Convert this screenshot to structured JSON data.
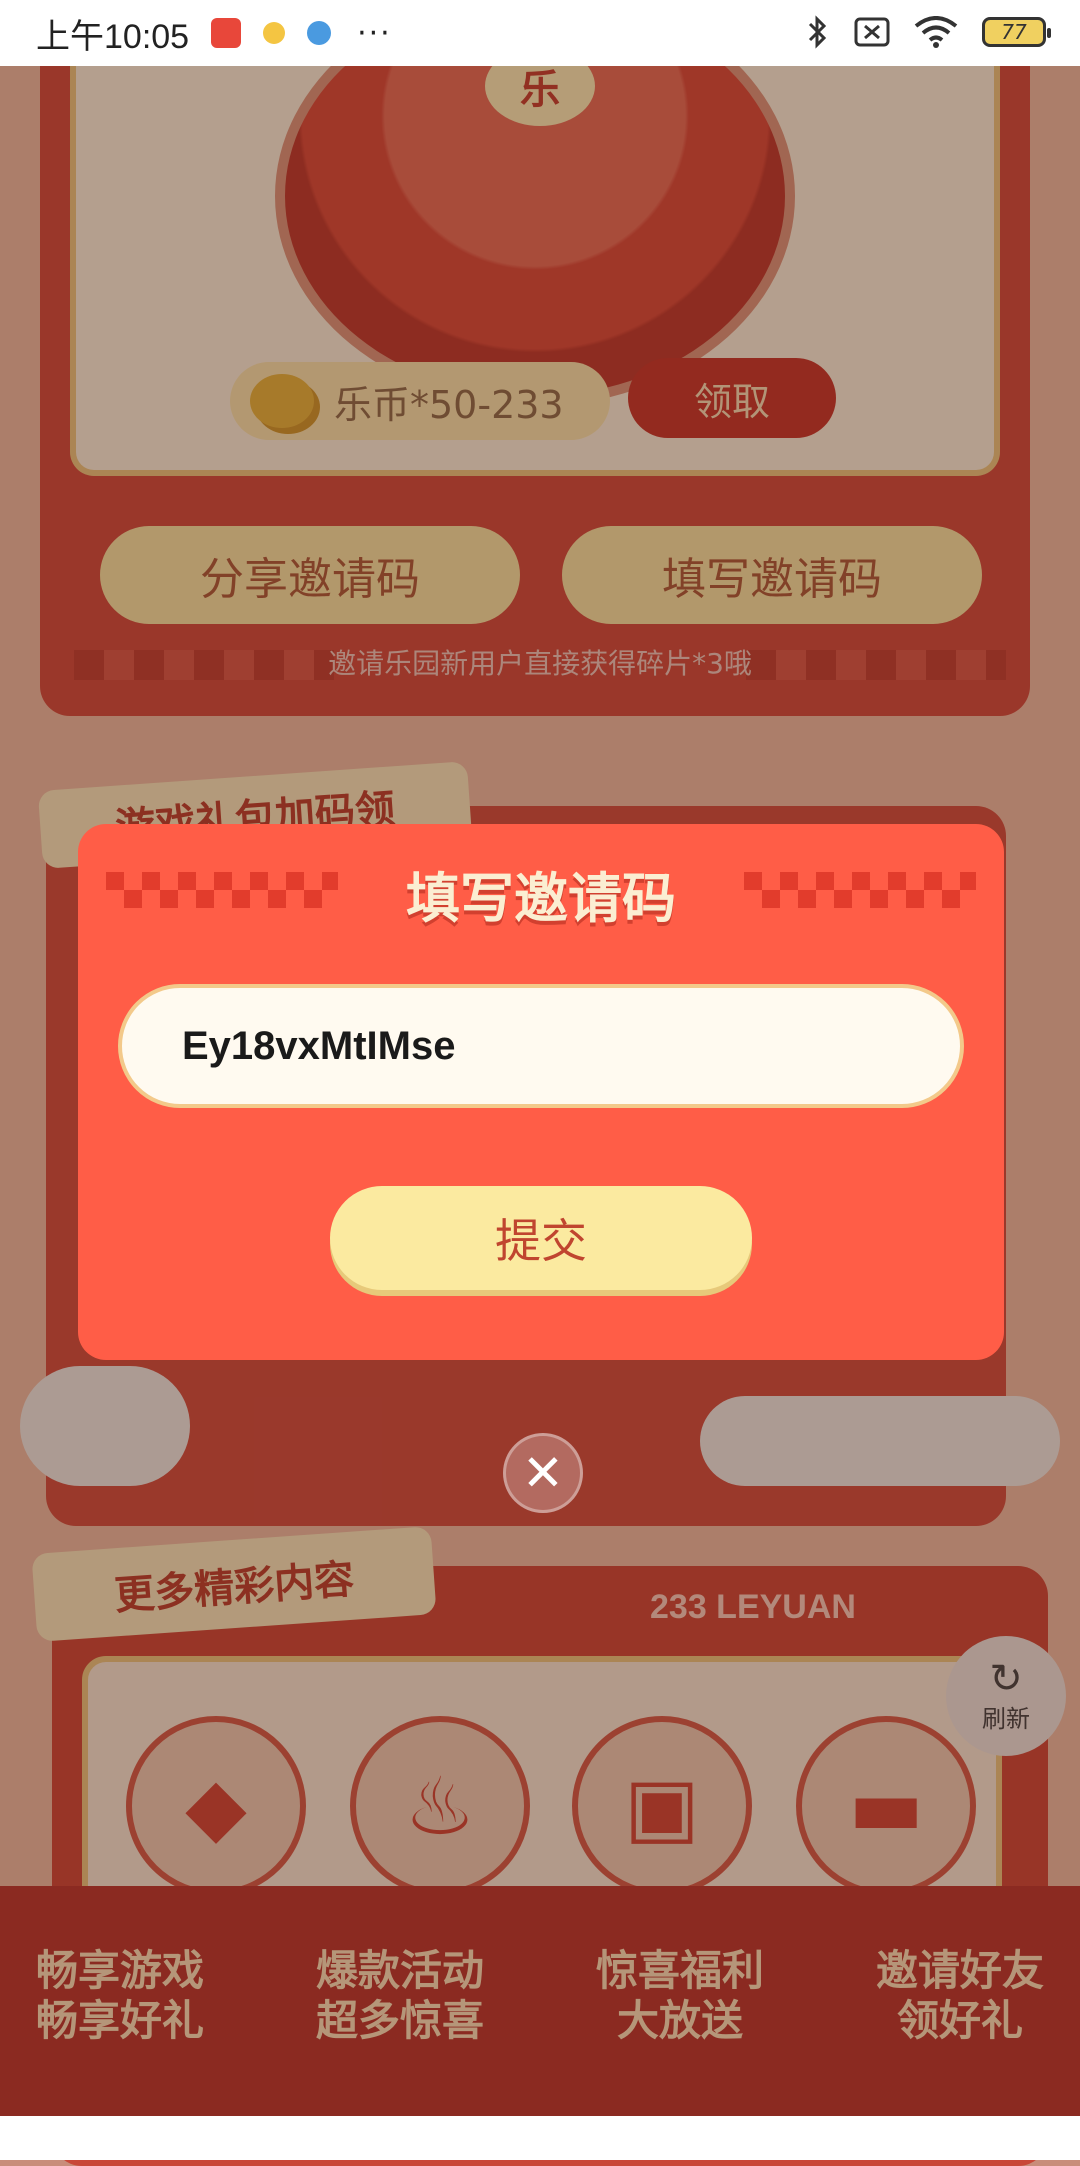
{
  "status_bar": {
    "time": "上午10:05",
    "more": "···",
    "battery": "77"
  },
  "background": {
    "wheel_center": "乐",
    "coin_reward": "乐币*50-233",
    "claim_button": "领取",
    "share_code_button": "分享邀请码",
    "fill_code_button": "填写邀请码",
    "invite_hint": "邀请乐园新用户直接获得碎片*3哦",
    "gift_section_title": "游戏礼包加码领",
    "more_section_title": "更多精彩内容",
    "leyuan_label": "233 LEYUAN",
    "refresh_label": "刷新",
    "features": [
      {
        "line1": "畅享游戏",
        "line2": "畅享好礼",
        "icon": "diamond-icon"
      },
      {
        "line1": "爆款活动",
        "line2": "超多惊喜",
        "icon": "flame-icon"
      },
      {
        "line1": "惊喜福利",
        "line2": "大放送",
        "icon": "gift-icon"
      },
      {
        "line1": "邀请好友",
        "line2": "领好礼",
        "icon": "chat-icon"
      }
    ]
  },
  "modal": {
    "title": "填写邀请码",
    "code_value": "Ey18vxMtIMse",
    "submit_label": "提交",
    "close_icon": "close-icon"
  },
  "colors": {
    "modal_bg": "#ff5d47",
    "input_bg": "#fffaf0",
    "submit_bg": "#fbeaa0",
    "accent_text": "#c0452f"
  }
}
